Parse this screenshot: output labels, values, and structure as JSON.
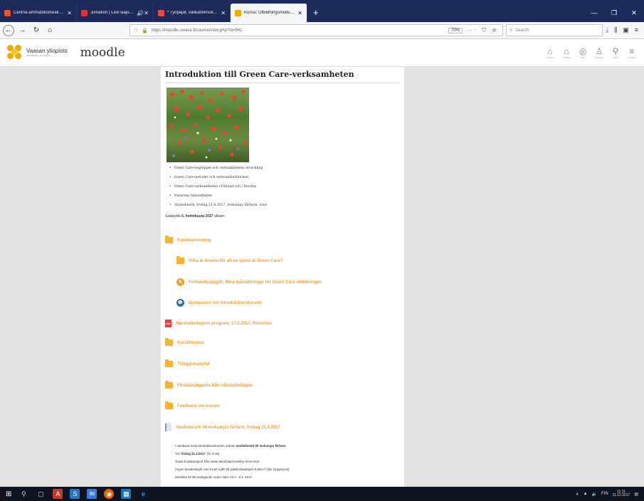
{
  "tabs": [
    {
      "title": "Centria-ammattikorkeakoulu",
      "favicon_color": "#e4572e",
      "active": false
    },
    {
      "title": "Julradion | LiveTaajuus.fi",
      "favicon_color": "#d33",
      "active": false
    },
    {
      "title": "* Työpajat, välikattelmukset ja",
      "favicon_color": "#e74c3c",
      "active": false
    },
    {
      "title": "Kurssi: Utbildningsmodul inom",
      "favicon_color": "#f2a900",
      "active": true
    }
  ],
  "browser": {
    "url": "https://moodle.uwasa.fi/course/view.php?id=941",
    "zoom": "70%",
    "search_placeholder": "Search"
  },
  "site": {
    "university": "Vaasan yliopisto",
    "university_sub": "UNIVERSITY OF VAASA",
    "brand": "moodle",
    "nav": [
      {
        "icon": "home-icon",
        "glyph": "⌂",
        "label": "ETUSIVU"
      },
      {
        "icon": "dashboard-icon",
        "glyph": "⌂",
        "label": "KURSSINI"
      },
      {
        "icon": "events-icon",
        "glyph": "◎",
        "label": "MIELI"
      },
      {
        "icon": "user-icon",
        "glyph": "♙",
        "label": "KIRJAUDU"
      },
      {
        "icon": "search-icon",
        "glyph": "⚲",
        "label": "HAKU"
      },
      {
        "icon": "menu-icon",
        "glyph": "≡",
        "label": "VALIKKO"
      }
    ]
  },
  "course": {
    "title": "Introduktion till Green Care-verksamheten",
    "topics": [
      "Green Care-begreppet och verksamhetens utveckling",
      "Green Care-metoder och verksamhetsformer",
      "Green Care-verksamheten i Finland och i Norden",
      "Naturens hälsoeffekter",
      "Studiebesök, fredag 21.4.2017, Isokumpu fårfarm, Sievi"
    ],
    "availability_prefix": "Saatavilla",
    "availability_date": "6. helmikuuta 2017",
    "availability_suffix": "alkaen",
    "activities": [
      {
        "label": "Kursbeskrivning",
        "type": "folder"
      },
      {
        "label": "Vilka är kraven för att en tjänst är Green Care?",
        "type": "folder"
      },
      {
        "label": "Förhandsuppgift; Mina målsättningar för Green Care utbildningen",
        "type": "assignment"
      },
      {
        "label": "Diskussion om Introduktionskursen",
        "type": "forum"
      },
      {
        "label": "Närstudiedagens program, 17.2.2017, Pörkenäs",
        "type": "pdf"
      },
      {
        "label": "Kurslitteratur",
        "type": "folder"
      },
      {
        "label": "Tilläggsmaterial",
        "type": "folder"
      },
      {
        "label": "Föreläsningarna från närstudiedagen",
        "type": "folder"
      },
      {
        "label": "Feedback om kursen",
        "type": "folder"
      },
      {
        "label": "Studiebesök till Isokumpu fårfarm, fredag 21.4.2017",
        "type": "book"
      }
    ],
    "visit_info": {
      "line1_pre": "I samband med introduktionskursen ordnas",
      "line1_bold": "studiebesök till Isokumpu fårfarm",
      "line2_pre": "Tid:",
      "line2_bold": "fredag 21.4.2017",
      "line2_post": ", (kl. 8-16)",
      "line3": "Gratis busstransport från Vasa-Jakobstad-Karleby-Sievi-retur",
      "line4": "(Ingen besöksavgift, lunch inkl. kaffe till självkostnadspris 8,50e /7,00e (sopplunch)",
      "line5": "Meddela hit ditt deltagande under tiden 23.2.- 6.4. 2017"
    }
  },
  "taskbar": {
    "lang": "FIN",
    "time": "11.11",
    "date": "11.12.2017"
  }
}
